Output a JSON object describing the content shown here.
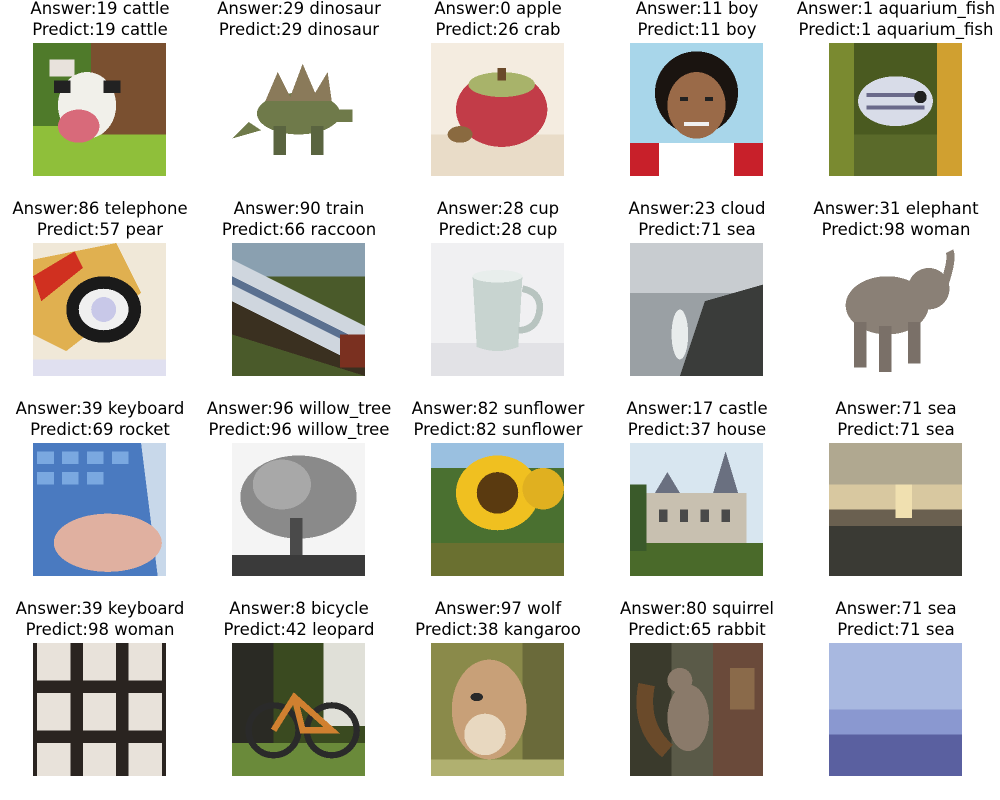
{
  "samples": [
    {
      "answer": "Answer:19 cattle",
      "predict": "Predict:19 cattle",
      "scene": "cattle"
    },
    {
      "answer": "Answer:29 dinosaur",
      "predict": "Predict:29 dinosaur",
      "scene": "dinosaur"
    },
    {
      "answer": "Answer:0 apple",
      "predict": "Predict:26 crab",
      "scene": "apple"
    },
    {
      "answer": "Answer:11 boy",
      "predict": "Predict:11 boy",
      "scene": "boy"
    },
    {
      "answer": "Answer:1 aquarium_fish",
      "predict": "Predict:1 aquarium_fish",
      "scene": "fish"
    },
    {
      "answer": "Answer:86 telephone",
      "predict": "Predict:57 pear",
      "scene": "telephone"
    },
    {
      "answer": "Answer:90 train",
      "predict": "Predict:66 raccoon",
      "scene": "train"
    },
    {
      "answer": "Answer:28 cup",
      "predict": "Predict:28 cup",
      "scene": "cup"
    },
    {
      "answer": "Answer:23 cloud",
      "predict": "Predict:71 sea",
      "scene": "cloud"
    },
    {
      "answer": "Answer:31 elephant",
      "predict": "Predict:98 woman",
      "scene": "elephant"
    },
    {
      "answer": "Answer:39 keyboard",
      "predict": "Predict:69 rocket",
      "scene": "keyboard_blue"
    },
    {
      "answer": "Answer:96 willow_tree",
      "predict": "Predict:96 willow_tree",
      "scene": "willow"
    },
    {
      "answer": "Answer:82 sunflower",
      "predict": "Predict:82 sunflower",
      "scene": "sunflower"
    },
    {
      "answer": "Answer:17 castle",
      "predict": "Predict:37 house",
      "scene": "castle"
    },
    {
      "answer": "Answer:71 sea",
      "predict": "Predict:71 sea",
      "scene": "sea_sunset"
    },
    {
      "answer": "Answer:39 keyboard",
      "predict": "Predict:98 woman",
      "scene": "keyboard_keys"
    },
    {
      "answer": "Answer:8 bicycle",
      "predict": "Predict:42 leopard",
      "scene": "bicycle"
    },
    {
      "answer": "Answer:97 wolf",
      "predict": "Predict:38 kangaroo",
      "scene": "wolf"
    },
    {
      "answer": "Answer:80 squirrel",
      "predict": "Predict:65 rabbit",
      "scene": "squirrel"
    },
    {
      "answer": "Answer:71 sea",
      "predict": "Predict:71 sea",
      "scene": "sea_blue"
    }
  ]
}
